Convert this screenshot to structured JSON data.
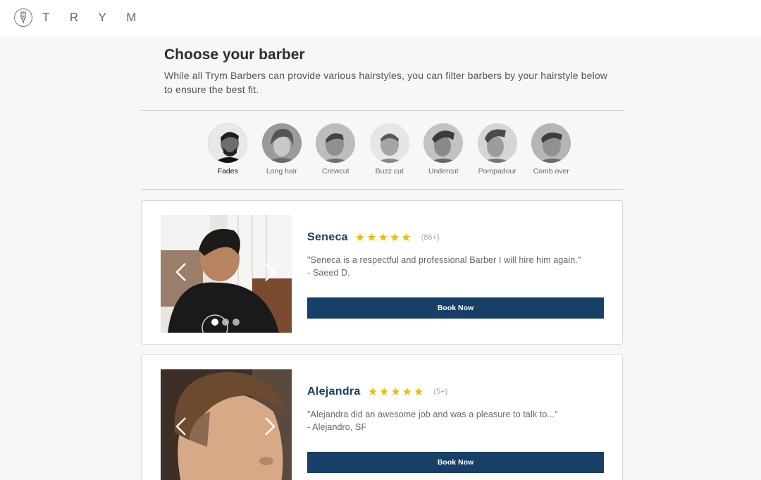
{
  "brand": {
    "name": "T R Y M",
    "logo_icon": "trym-logo-icon"
  },
  "header": {
    "title": "Choose your barber",
    "subtitle": "While all Trym Barbers can provide various hairstyles, you can filter barbers by your hairstyle below to ensure the best fit."
  },
  "hairstyles": [
    {
      "label": "Fades",
      "active": true
    },
    {
      "label": "Long hair",
      "active": false
    },
    {
      "label": "Crewcut",
      "active": false
    },
    {
      "label": "Buzz cut",
      "active": false
    },
    {
      "label": "Undercut",
      "active": false
    },
    {
      "label": "Pompadour",
      "active": false
    },
    {
      "label": "Comb over",
      "active": false
    }
  ],
  "barbers": [
    {
      "name": "Seneca",
      "stars": "★★★★★",
      "count": "(86+)",
      "review": "\"Seneca is a respectful and professional Barber I will hire him again.\"",
      "reviewer": "- Saeed D.",
      "book_label": "Book Now"
    },
    {
      "name": "Alejandra",
      "stars": "★★★★★",
      "count": "(5+)",
      "review": "\"Alejandra did an awesome job and was a pleasure to talk to...\"",
      "reviewer": "- Alejandro, SF",
      "book_label": "Book Now"
    }
  ],
  "colors": {
    "accent": "#173f68",
    "star": "#f2b807",
    "background": "#f7f7f7"
  }
}
